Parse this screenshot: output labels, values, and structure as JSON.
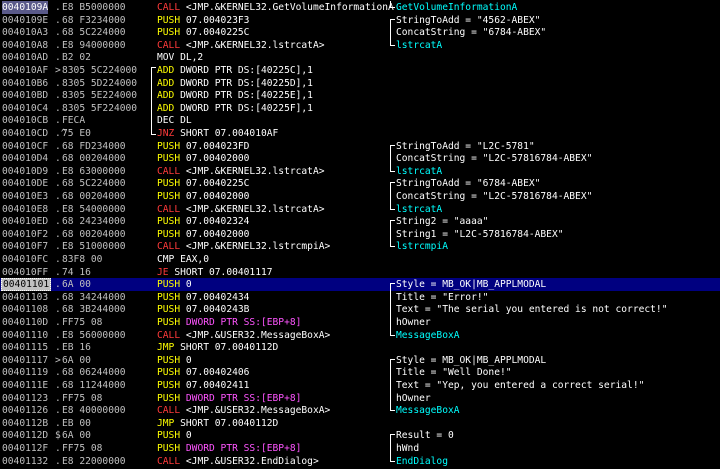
{
  "window": {
    "title": ""
  },
  "colors": {
    "background": "#000000",
    "selected_row": "#000080",
    "call": "#ff3a3a",
    "push": "#ffff00",
    "stack_arg": "#ff55ff",
    "api_name": "#00ffff"
  },
  "rows": [
    {
      "addr": "0040109A",
      "mark": ".",
      "hex": "E8 B5000000",
      "mn": "CALL",
      "arg": "<JMP.&KERNEL32.GetVolumeInformationA",
      "cls": "c-call",
      "cmt": "GetVolumeInformationA",
      "cmtcls": "api-name"
    },
    {
      "addr": "0040109E",
      "mark": ".",
      "hex": "68 F3234000",
      "mn": "PUSH",
      "arg": "07.004023F3",
      "cls": "c-push",
      "cmt": "StringToAdd = \"4562-ABEX\"",
      "cmtcls": "api"
    },
    {
      "addr": "004010A3",
      "mark": ".",
      "hex": "68 5C224000",
      "mn": "PUSH",
      "arg": "07.0040225C",
      "cls": "c-push",
      "cmt": "ConcatString = \"6784-ABEX\"",
      "cmtcls": "api"
    },
    {
      "addr": "004010A8",
      "mark": ".",
      "hex": "E8 94000000",
      "mn": "CALL",
      "arg": "<JMP.&KERNEL32.lstrcatA>",
      "cls": "c-call",
      "cmt": "lstrcatA",
      "cmtcls": "api-name"
    },
    {
      "addr": "004010AD",
      "mark": ".",
      "hex": "B2 02",
      "mn": "MOV",
      "arg": "DL,2",
      "cls": "c-mov",
      "cmt": "",
      "cmtcls": "api"
    },
    {
      "addr": "004010AF",
      "mark": ">",
      "hex": "8305 5C224000",
      "mn": "ADD",
      "arg": "DWORD PTR DS:[40225C],1",
      "cls": "c-add",
      "cmt": "",
      "cmtcls": "api"
    },
    {
      "addr": "004010B6",
      "mark": ".",
      "hex": "8305 5D224000",
      "mn": "ADD",
      "arg": "DWORD PTR DS:[40225D],1",
      "cls": "c-add",
      "cmt": "",
      "cmtcls": "api"
    },
    {
      "addr": "004010BD",
      "mark": ".",
      "hex": "8305 5E224000",
      "mn": "ADD",
      "arg": "DWORD PTR DS:[40225E],1",
      "cls": "c-add",
      "cmt": "",
      "cmtcls": "api"
    },
    {
      "addr": "004010C4",
      "mark": ".",
      "hex": "8305 5F224000",
      "mn": "ADD",
      "arg": "DWORD PTR DS:[40225F],1",
      "cls": "c-add",
      "cmt": "",
      "cmtcls": "api"
    },
    {
      "addr": "004010CB",
      "mark": ".",
      "hex": "FECA",
      "mn": "DEC",
      "arg": "DL",
      "cls": "c-dec",
      "cmt": "",
      "cmtcls": "api"
    },
    {
      "addr": "004010CD",
      "mark": ".^",
      "hex": "75 E0",
      "mn": "JNZ",
      "arg": "SHORT 07.004010AF",
      "cls": "c-jump",
      "cmt": "",
      "cmtcls": "api"
    },
    {
      "addr": "004010CF",
      "mark": ".",
      "hex": "68 FD234000",
      "mn": "PUSH",
      "arg": "07.004023FD",
      "cls": "c-push",
      "cmt": "StringToAdd = \"L2C-5781\"",
      "cmtcls": "api"
    },
    {
      "addr": "004010D4",
      "mark": ".",
      "hex": "68 00204000",
      "mn": "PUSH",
      "arg": "07.00402000",
      "cls": "c-push",
      "cmt": "ConcatString = \"L2C-57816784-ABEX\"",
      "cmtcls": "api"
    },
    {
      "addr": "004010D9",
      "mark": ".",
      "hex": "E8 63000000",
      "mn": "CALL",
      "arg": "<JMP.&KERNEL32.lstrcatA>",
      "cls": "c-call",
      "cmt": "lstrcatA",
      "cmtcls": "api-name"
    },
    {
      "addr": "004010DE",
      "mark": ".",
      "hex": "68 5C224000",
      "mn": "PUSH",
      "arg": "07.0040225C",
      "cls": "c-push",
      "cmt": "StringToAdd = \"6784-ABEX\"",
      "cmtcls": "api"
    },
    {
      "addr": "004010E3",
      "mark": ".",
      "hex": "68 00204000",
      "mn": "PUSH",
      "arg": "07.00402000",
      "cls": "c-push",
      "cmt": "ConcatString = \"L2C-57816784-ABEX\"",
      "cmtcls": "api"
    },
    {
      "addr": "004010E8",
      "mark": ".",
      "hex": "E8 54000000",
      "mn": "CALL",
      "arg": "<JMP.&KERNEL32.lstrcatA>",
      "cls": "c-call",
      "cmt": "lstrcatA",
      "cmtcls": "api-name"
    },
    {
      "addr": "004010ED",
      "mark": ".",
      "hex": "68 24234000",
      "mn": "PUSH",
      "arg": "07.00402324",
      "cls": "c-push",
      "cmt": "String2 = \"aaaa\"",
      "cmtcls": "api"
    },
    {
      "addr": "004010F2",
      "mark": ".",
      "hex": "68 00204000",
      "mn": "PUSH",
      "arg": "07.00402000",
      "cls": "c-push",
      "cmt": "String1 = \"L2C-57816784-ABEX\"",
      "cmtcls": "api"
    },
    {
      "addr": "004010F7",
      "mark": ".",
      "hex": "E8 51000000",
      "mn": "CALL",
      "arg": "<JMP.&KERNEL32.lstrcmpiA>",
      "cls": "c-call",
      "cmt": "lstrcmpiA",
      "cmtcls": "api-name"
    },
    {
      "addr": "004010FC",
      "mark": ".",
      "hex": "83F8 00",
      "mn": "CMP",
      "arg": "EAX,0",
      "cls": "c-cmp",
      "cmt": "",
      "cmtcls": "api"
    },
    {
      "addr": "004010FF",
      "mark": ".",
      "hex": "74 16",
      "mn": "JE",
      "arg": "SHORT 07.00401117",
      "cls": "c-jump",
      "cmt": "",
      "cmtcls": "api"
    },
    {
      "addr": "00401101",
      "mark": ".",
      "hex": "6A 00",
      "mn": "PUSH",
      "arg": "0",
      "cls": "c-push",
      "cmt": "Style = MB_OK|MB_APPLMODAL",
      "cmtcls": "api",
      "selected": true
    },
    {
      "addr": "00401103",
      "mark": ".",
      "hex": "68 34244000",
      "mn": "PUSH",
      "arg": "07.00402434",
      "cls": "c-push",
      "cmt": "Title = \"Error!\"",
      "cmtcls": "api"
    },
    {
      "addr": "00401108",
      "mark": ".",
      "hex": "68 3B244000",
      "mn": "PUSH",
      "arg": "07.0040243B",
      "cls": "c-push",
      "cmt": "Text = \"The serial you entered is not correct!\"",
      "cmtcls": "api"
    },
    {
      "addr": "0040110D",
      "mark": ".",
      "hex": "FF75 08",
      "mn": "PUSH",
      "arg": "DWORD PTR SS:[EBP+8]",
      "cls": "c-pushm",
      "cmt": "hOwner",
      "cmtcls": "api"
    },
    {
      "addr": "00401110",
      "mark": ".",
      "hex": "E8 56000000",
      "mn": "CALL",
      "arg": "<JMP.&USER32.MessageBoxA>",
      "cls": "c-call",
      "cmt": "MessageBoxA",
      "cmtcls": "api-name"
    },
    {
      "addr": "00401115",
      "mark": ".",
      "hex": "EB 16",
      "mn": "JMP",
      "arg": "SHORT 07.0040112D",
      "cls": "c-jmp",
      "cmt": "",
      "cmtcls": "api"
    },
    {
      "addr": "00401117",
      "mark": ">",
      "hex": "6A 00",
      "mn": "PUSH",
      "arg": "0",
      "cls": "c-push",
      "cmt": "Style = MB_OK|MB_APPLMODAL",
      "cmtcls": "api"
    },
    {
      "addr": "00401119",
      "mark": ".",
      "hex": "68 06244000",
      "mn": "PUSH",
      "arg": "07.00402406",
      "cls": "c-push",
      "cmt": "Title = \"Well Done!\"",
      "cmtcls": "api"
    },
    {
      "addr": "0040111E",
      "mark": ".",
      "hex": "68 11244000",
      "mn": "PUSH",
      "arg": "07.00402411",
      "cls": "c-push",
      "cmt": "Text = \"Yep, you entered a correct serial!\"",
      "cmtcls": "api"
    },
    {
      "addr": "00401123",
      "mark": ".",
      "hex": "FF75 08",
      "mn": "PUSH",
      "arg": "DWORD PTR SS:[EBP+8]",
      "cls": "c-pushm",
      "cmt": "hOwner",
      "cmtcls": "api"
    },
    {
      "addr": "00401126",
      "mark": ".",
      "hex": "E8 40000000",
      "mn": "CALL",
      "arg": "<JMP.&USER32.MessageBoxA>",
      "cls": "c-call",
      "cmt": "MessageBoxA",
      "cmtcls": "api-name"
    },
    {
      "addr": "0040112B",
      "mark": ".",
      "hex": "EB 00",
      "mn": "JMP",
      "arg": "SHORT 07.0040112D",
      "cls": "c-jmp",
      "cmt": "",
      "cmtcls": "api"
    },
    {
      "addr": "0040112D",
      "mark": "$",
      "hex": "6A 00",
      "mn": "PUSH",
      "arg": "0",
      "cls": "c-push",
      "cmt": "Result = 0",
      "cmtcls": "api"
    },
    {
      "addr": "0040112F",
      "mark": ".",
      "hex": "FF75 08",
      "mn": "PUSH",
      "arg": "DWORD PTR SS:[EBP+8]",
      "cls": "c-pushm",
      "cmt": "hWnd",
      "cmtcls": "api"
    },
    {
      "addr": "00401132",
      "mark": ".",
      "hex": "E8 22000000",
      "mn": "CALL",
      "arg": "<JMP.&USER32.EndDialog>",
      "cls": "c-call",
      "cmt": "EndDialog",
      "cmtcls": "api-name"
    }
  ]
}
